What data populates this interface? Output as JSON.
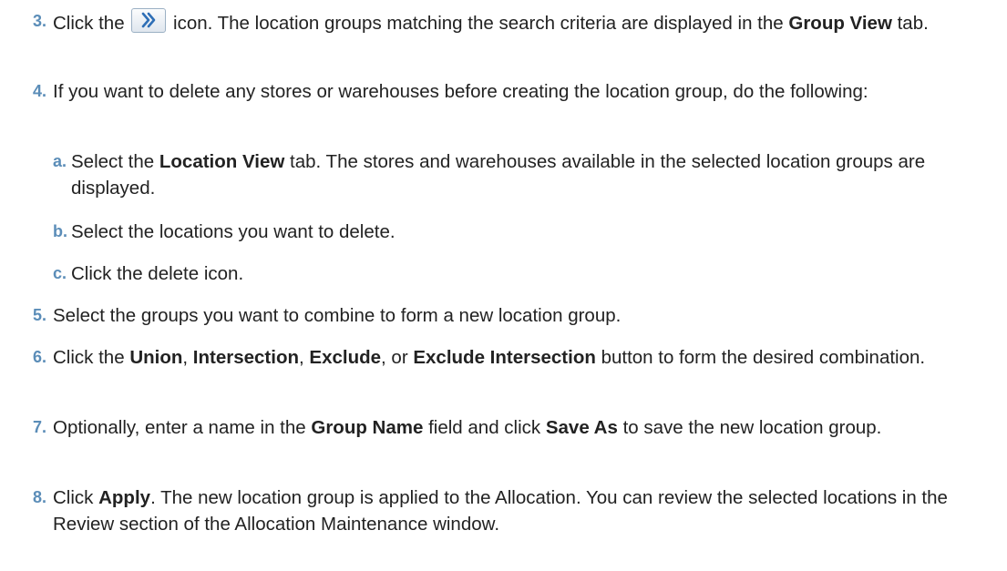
{
  "steps": [
    {
      "num": "3.",
      "before": "Click the",
      "icon": "chevron-double-right-icon",
      "after": " icon. The location groups matching the search criteria are displayed in the",
      "bold1": "Group View",
      "tail": " tab."
    },
    {
      "num": "4.",
      "text": "If you want to delete any stores or warehouses before creating the location group, do the following:"
    },
    {
      "num": "a.",
      "pre": "Select the ",
      "bold1": "Location View",
      "tail": " tab. The stores and warehouses available in the selected location groups are displayed."
    },
    {
      "num": "b.",
      "text": "Select the locations you want to delete."
    },
    {
      "num": "c.",
      "text": "Click the delete icon."
    },
    {
      "num": "5.",
      "text": "Select the groups you want to combine to form a new location group."
    },
    {
      "num": "6.",
      "pre": "Click the ",
      "b1": "Union",
      "s1": ", ",
      "b2": "Intersection",
      "s2": ", ",
      "b3": "Exclude",
      "s3": ", or ",
      "b4": "Exclude Intersection",
      "tail": " button to form the desired combination."
    },
    {
      "num": "7.",
      "pre": "Optionally, enter a name in the ",
      "b1": "Group Name",
      "s1": " field and click ",
      "b2": "Save As",
      "tail": " to save the new location group."
    },
    {
      "num": "8.",
      "pre": "Click ",
      "b1": "Apply",
      "tail": ". The new location group is applied to the Allocation. You can review the selected locations in the Review section of the Allocation Maintenance window."
    }
  ],
  "colors": {
    "number": "#5b8db8",
    "text": "#222222"
  }
}
